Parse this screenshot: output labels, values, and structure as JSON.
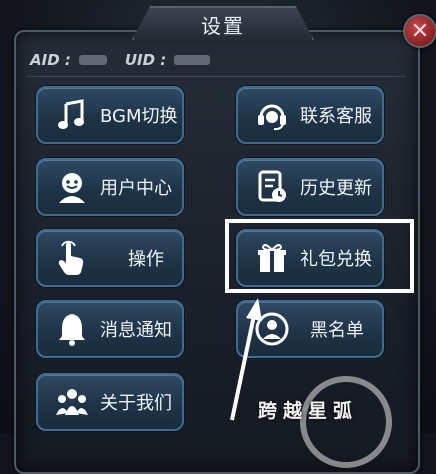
{
  "dialog": {
    "title": "设置",
    "close_label": "✕",
    "aid_label": "AID :",
    "uid_label": "UID :"
  },
  "buttons": [
    {
      "id": "bgm",
      "label": "BGM切换",
      "icon": "music-note-icon"
    },
    {
      "id": "support",
      "label": "联系客服",
      "icon": "headset-icon"
    },
    {
      "id": "user",
      "label": "用户中心",
      "icon": "user-icon"
    },
    {
      "id": "history",
      "label": "历史更新",
      "icon": "document-clock-icon"
    },
    {
      "id": "control",
      "label": "操作",
      "icon": "hand-pointer-icon"
    },
    {
      "id": "gift",
      "label": "礼包兑换",
      "icon": "gift-icon"
    },
    {
      "id": "message",
      "label": "消息通知",
      "icon": "bell-icon"
    },
    {
      "id": "blacklist",
      "label": "黑名单",
      "icon": "blocked-user-icon"
    },
    {
      "id": "about",
      "label": "关于我们",
      "icon": "group-icon"
    }
  ],
  "watermark": {
    "text": "跨越星弧"
  },
  "colors": {
    "button_border": "#3f6d92",
    "highlight": "#ffffff",
    "close": "#8a1f22"
  }
}
